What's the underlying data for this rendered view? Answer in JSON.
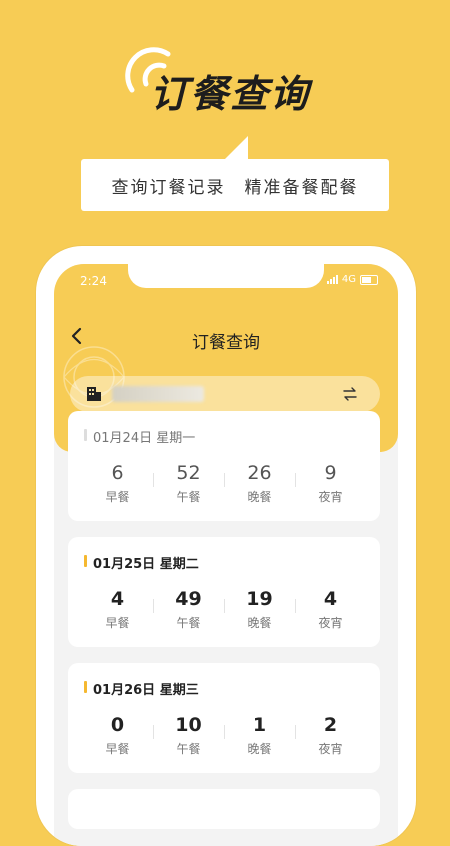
{
  "promo": {
    "title": "订餐查询",
    "tagline": "查询订餐记录　精准备餐配餐"
  },
  "status_bar": {
    "time": "2:24",
    "network": "4G"
  },
  "nav": {
    "title": "订餐查询"
  },
  "store_selector": {
    "store_name": ""
  },
  "days": [
    {
      "date": "01月24日  星期一",
      "meals": [
        {
          "count": "6",
          "label": "早餐"
        },
        {
          "count": "52",
          "label": "午餐"
        },
        {
          "count": "26",
          "label": "晚餐"
        },
        {
          "count": "9",
          "label": "夜宵"
        }
      ]
    },
    {
      "date": "01月25日  星期二",
      "meals": [
        {
          "count": "4",
          "label": "早餐"
        },
        {
          "count": "49",
          "label": "午餐"
        },
        {
          "count": "19",
          "label": "晚餐"
        },
        {
          "count": "4",
          "label": "夜宵"
        }
      ]
    },
    {
      "date": "01月26日  星期三",
      "meals": [
        {
          "count": "0",
          "label": "早餐"
        },
        {
          "count": "10",
          "label": "午餐"
        },
        {
          "count": "1",
          "label": "晚餐"
        },
        {
          "count": "2",
          "label": "夜宵"
        }
      ]
    }
  ],
  "colors": {
    "background": "#F7CC55",
    "accent_bar": "#F5B830",
    "card": "#FFFFFF"
  }
}
